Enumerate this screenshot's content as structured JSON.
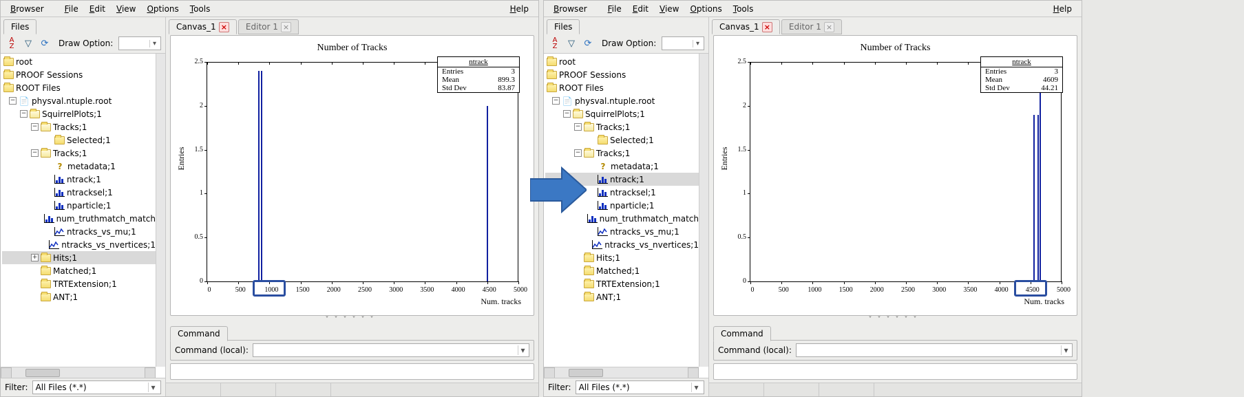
{
  "menubar": {
    "browser": "Browser",
    "file": "File",
    "edit": "Edit",
    "view": "View",
    "options": "Options",
    "tools": "Tools",
    "help": "Help"
  },
  "sidebar": {
    "tab_files": "Files",
    "sort_icon": "A↕Z",
    "filter_icon": "▽",
    "refresh_icon": "↻",
    "draw_option_label": "Draw Option:",
    "draw_option_value": "",
    "filter_label": "Filter:",
    "filter_value": "All Files (*.*)"
  },
  "tree": {
    "root": "root",
    "proof": "PROOF Sessions",
    "rootfiles": "ROOT Files",
    "file": "physval.ntuple.root",
    "squirrel": "SquirrelPlots;1",
    "tracks1": "Tracks;1",
    "selected": "Selected;1",
    "tracks2": "Tracks;1",
    "metadata": "metadata;1",
    "ntrack": "ntrack;1",
    "ntracksel": "ntracksel;1",
    "nparticle": "nparticle;1",
    "num_truthmatch": "num_truthmatch_match",
    "ntracks_vs_mu": "ntracks_vs_mu;1",
    "ntracks_vs_nvert": "ntracks_vs_nvertices;1",
    "hits": "Hits;1",
    "matched": "Matched;1",
    "trtext": "TRTExtension;1",
    "ant": "ANT;1"
  },
  "canvas": {
    "tab_canvas": "Canvas_1",
    "tab_editor": "Editor 1",
    "command_tab": "Command",
    "command_local_label": "Command (local):"
  },
  "chart_data": [
    {
      "type": "bar",
      "title": "Number of Tracks",
      "xlabel": "Num. tracks",
      "ylabel": "Entries",
      "xlim": [
        0,
        5000
      ],
      "ylim": [
        0,
        2.5
      ],
      "xticks": [
        0,
        500,
        1000,
        1500,
        2000,
        2500,
        3000,
        3500,
        4000,
        4500,
        5000
      ],
      "yticks": [
        0,
        0.5,
        1,
        1.5,
        2,
        2.5
      ],
      "stats": {
        "name": "ntrack",
        "Entries": "3",
        "Mean": "899.3",
        "Std Dev": "83.87"
      },
      "bars": [
        {
          "x": 830,
          "y": 2.4
        },
        {
          "x": 870,
          "y": 2.4
        },
        {
          "x": 4500,
          "y": 2.0
        }
      ],
      "highlight_x": 1000
    },
    {
      "type": "bar",
      "title": "Number of Tracks",
      "xlabel": "Num. tracks",
      "ylabel": "Entries",
      "xlim": [
        0,
        5000
      ],
      "ylim": [
        0,
        2.5
      ],
      "xticks": [
        0,
        500,
        1000,
        1500,
        2000,
        2500,
        3000,
        3500,
        4000,
        4500,
        5000
      ],
      "yticks": [
        0,
        0.5,
        1,
        1.5,
        2,
        2.5
      ],
      "stats": {
        "name": "ntrack",
        "Entries": "3",
        "Mean": "4609",
        "Std Dev": "44.21"
      },
      "bars": [
        {
          "x": 4560,
          "y": 1.9
        },
        {
          "x": 4620,
          "y": 1.9
        },
        {
          "x": 4660,
          "y": 2.4
        }
      ],
      "highlight_x": 4500
    }
  ]
}
